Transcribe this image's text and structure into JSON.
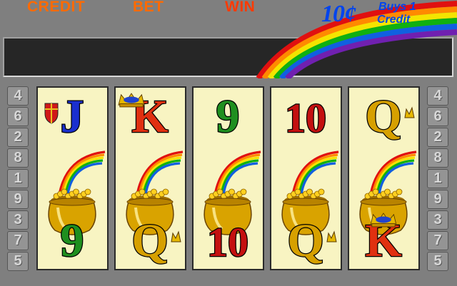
{
  "header": {
    "credit_label": "CREDIT",
    "bet_label": "BET",
    "win_label": "WIN"
  },
  "denomination": {
    "price": "10¢",
    "line1": "Buys 1",
    "line2": "Credit"
  },
  "paylines": {
    "left": [
      "4",
      "6",
      "2",
      "8",
      "1",
      "9",
      "3",
      "7",
      "5"
    ],
    "right": [
      "4",
      "6",
      "2",
      "8",
      "1",
      "9",
      "3",
      "7",
      "5"
    ]
  },
  "reels": [
    {
      "symbols": [
        "J",
        "pot",
        "9"
      ]
    },
    {
      "symbols": [
        "K",
        "pot",
        "Q"
      ]
    },
    {
      "symbols": [
        "9",
        "pot",
        "10"
      ]
    },
    {
      "symbols": [
        "10",
        "pot",
        "Q"
      ]
    },
    {
      "symbols": [
        "Q",
        "pot",
        "K"
      ]
    }
  ],
  "symbol_icons": {
    "J": "shield-icon",
    "K": "crown-icon",
    "Q": "crown-small-icon",
    "pot": "pot-of-gold-icon"
  },
  "colors": {
    "9": "#1f8f1f",
    "10": "#c41010",
    "J": "#1a2fcf",
    "K": "#e03010",
    "Q": "#d6a000"
  }
}
